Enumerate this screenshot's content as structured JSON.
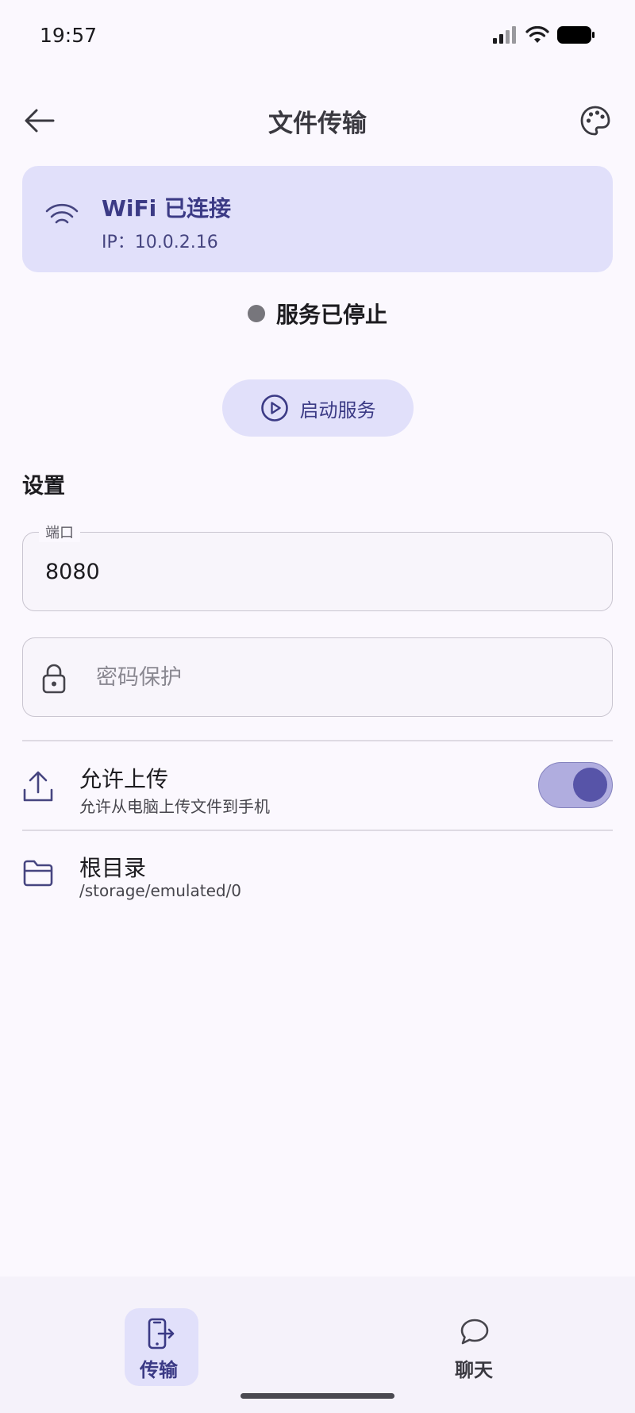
{
  "status_bar": {
    "time": "19:57"
  },
  "app_bar": {
    "title": "文件传输",
    "back_icon": "arrow-left-icon",
    "palette_icon": "palette-icon"
  },
  "wifi_card": {
    "title": "WiFi 已连接",
    "ip": "IP：10.0.2.16"
  },
  "service": {
    "status": "服务已停止",
    "start_label": "启动服务"
  },
  "settings": {
    "title": "设置",
    "port": {
      "label": "端口",
      "value": "8080"
    },
    "password": {
      "placeholder": "密码保护",
      "value": ""
    },
    "allow_upload": {
      "title": "允许上传",
      "subtitle": "允许从电脑上传文件到手机",
      "enabled": true
    },
    "root_dir": {
      "title": "根目录",
      "path": "/storage/emulated/0"
    }
  },
  "bottom_nav": {
    "items": [
      {
        "label": "传输",
        "icon": "phone-transfer-icon",
        "active": true
      },
      {
        "label": "聊天",
        "icon": "chat-bubble-icon",
        "active": false
      }
    ]
  },
  "colors": {
    "accent": "#5754a8",
    "card_bg": "#e1e0fa",
    "background": "#fbf8fe"
  }
}
